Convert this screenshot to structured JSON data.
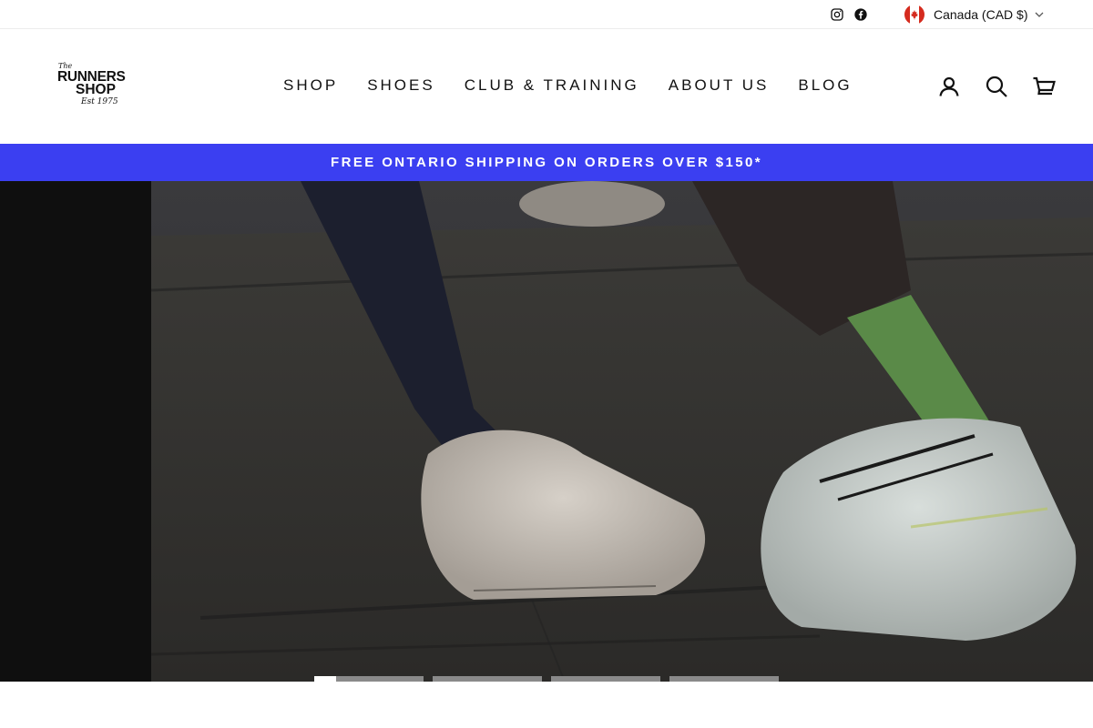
{
  "topbar": {
    "social": [
      {
        "name": "Instagram",
        "icon": "instagram-icon"
      },
      {
        "name": "Facebook",
        "icon": "facebook-icon"
      }
    ],
    "currency": {
      "label": "Canada (CAD $)",
      "flag_icon": "canada-flag-icon"
    }
  },
  "header": {
    "logo": {
      "line1": "The",
      "line2": "RUNNERS",
      "line3": "SHOP",
      "line4": "Est 1975"
    },
    "nav": [
      {
        "label": "SHOP"
      },
      {
        "label": "SHOES"
      },
      {
        "label": "CLUB & TRAINING"
      },
      {
        "label": "ABOUT US"
      },
      {
        "label": "BLOG"
      }
    ],
    "icons": {
      "account_label": "LOG IN",
      "search_label": "SEARCH",
      "cart_label": "CART"
    }
  },
  "announcement": {
    "text": "FREE ONTARIO SHIPPING ON ORDERS OVER $150*",
    "background": "#3b3ff1"
  },
  "hero": {
    "slides": [
      {
        "progress": 0.2
      },
      {
        "progress": 0
      },
      {
        "progress": 0
      },
      {
        "progress": 0
      }
    ],
    "active_slide": 1
  }
}
